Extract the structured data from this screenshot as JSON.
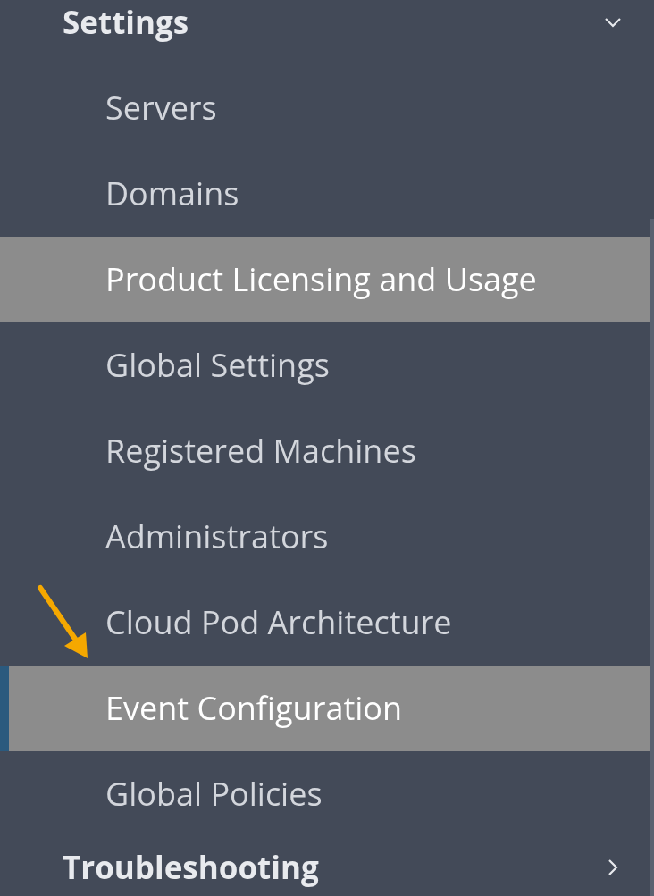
{
  "sections": [
    {
      "label": "Settings",
      "expanded": true,
      "items": [
        {
          "label": "Servers",
          "highlighted": false,
          "selected": false
        },
        {
          "label": "Domains",
          "highlighted": false,
          "selected": false
        },
        {
          "label": "Product Licensing and Usage",
          "highlighted": true,
          "selected": false
        },
        {
          "label": "Global Settings",
          "highlighted": false,
          "selected": false
        },
        {
          "label": "Registered Machines",
          "highlighted": false,
          "selected": false
        },
        {
          "label": "Administrators",
          "highlighted": false,
          "selected": false
        },
        {
          "label": "Cloud Pod Architecture",
          "highlighted": false,
          "selected": false
        },
        {
          "label": "Event Configuration",
          "highlighted": true,
          "selected": true
        },
        {
          "label": "Global Policies",
          "highlighted": false,
          "selected": false
        }
      ]
    },
    {
      "label": "Troubleshooting",
      "expanded": false
    }
  ]
}
